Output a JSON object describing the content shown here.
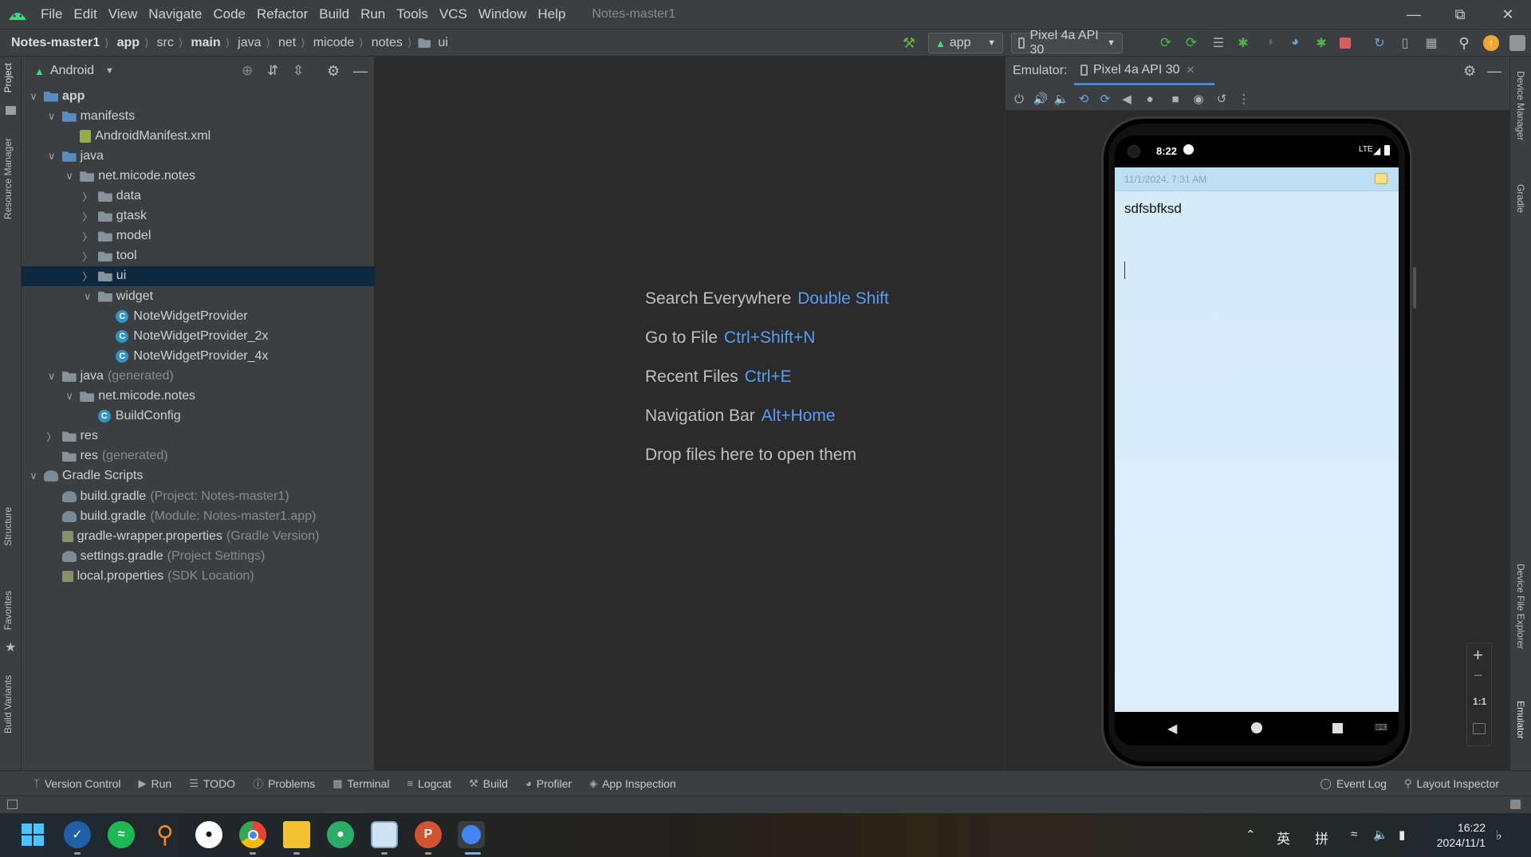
{
  "menubar": {
    "items": [
      "File",
      "Edit",
      "View",
      "Navigate",
      "Code",
      "Refactor",
      "Build",
      "Run",
      "Tools",
      "VCS",
      "Window",
      "Help"
    ],
    "project_title": "Notes-master1"
  },
  "breadcrumbs": [
    "Notes-master1",
    "app",
    "src",
    "main",
    "java",
    "net",
    "micode",
    "notes",
    "ui"
  ],
  "toolbar": {
    "run_config": "app",
    "device": "Pixel 4a API 30"
  },
  "left_tabs": [
    "Project",
    "Resource Manager",
    "Structure",
    "Favorites",
    "Build Variants"
  ],
  "right_tabs": [
    "Device Manager",
    "Gradle",
    "Device File Explorer",
    "Emulator"
  ],
  "project_panel": {
    "view_mode": "Android",
    "tree": [
      {
        "label": "app",
        "indent": 0,
        "expanded": true,
        "icon": "module-folder"
      },
      {
        "label": "manifests",
        "indent": 1,
        "expanded": true,
        "icon": "folder"
      },
      {
        "label": "AndroidManifest.xml",
        "indent": 2,
        "icon": "manifest-file"
      },
      {
        "label": "java",
        "indent": 1,
        "expanded": true,
        "icon": "folder"
      },
      {
        "label": "net.micode.notes",
        "indent": 2,
        "expanded": true,
        "icon": "package"
      },
      {
        "label": "data",
        "indent": 3,
        "expanded": false,
        "icon": "package"
      },
      {
        "label": "gtask",
        "indent": 3,
        "expanded": false,
        "icon": "package"
      },
      {
        "label": "model",
        "indent": 3,
        "expanded": false,
        "icon": "package"
      },
      {
        "label": "tool",
        "indent": 3,
        "expanded": false,
        "icon": "package"
      },
      {
        "label": "ui",
        "indent": 3,
        "expanded": false,
        "icon": "package",
        "selected": true
      },
      {
        "label": "widget",
        "indent": 3,
        "expanded": true,
        "icon": "package"
      },
      {
        "label": "NoteWidgetProvider",
        "indent": 4,
        "icon": "class"
      },
      {
        "label": "NoteWidgetProvider_2x",
        "indent": 4,
        "icon": "class"
      },
      {
        "label": "NoteWidgetProvider_4x",
        "indent": 4,
        "icon": "class"
      },
      {
        "label": "java",
        "note": "(generated)",
        "indent": 1,
        "expanded": true,
        "icon": "generated-folder"
      },
      {
        "label": "net.micode.notes",
        "indent": 2,
        "expanded": true,
        "icon": "package"
      },
      {
        "label": "BuildConfig",
        "indent": 3,
        "icon": "class"
      },
      {
        "label": "res",
        "indent": 1,
        "expanded": false,
        "icon": "res-folder"
      },
      {
        "label": "res",
        "note": "(generated)",
        "indent": 1,
        "icon": "res-folder"
      },
      {
        "label": "Gradle Scripts",
        "indent": 0,
        "expanded": true,
        "icon": "gradle"
      },
      {
        "label": "build.gradle",
        "note": "(Project: Notes-master1)",
        "indent": 1,
        "icon": "gradle"
      },
      {
        "label": "build.gradle",
        "note": "(Module: Notes-master1.app)",
        "indent": 1,
        "icon": "gradle"
      },
      {
        "label": "gradle-wrapper.properties",
        "note": "(Gradle Version)",
        "indent": 1,
        "icon": "properties"
      },
      {
        "label": "settings.gradle",
        "note": "(Project Settings)",
        "indent": 1,
        "icon": "gradle"
      },
      {
        "label": "local.properties",
        "note": "(SDK Location)",
        "indent": 1,
        "icon": "properties"
      }
    ]
  },
  "editor_hints": [
    {
      "text": "Search Everywhere",
      "key": "Double Shift"
    },
    {
      "text": "Go to File",
      "key": "Ctrl+Shift+N"
    },
    {
      "text": "Recent Files",
      "key": "Ctrl+E"
    },
    {
      "text": "Navigation Bar",
      "key": "Alt+Home"
    },
    {
      "text": "Drop files here to open them",
      "key": ""
    }
  ],
  "emulator": {
    "label": "Emulator:",
    "tab": "Pixel 4a API 30",
    "zoom_ratio": "1:1",
    "phone": {
      "time": "8:22",
      "network": "LTE",
      "note_date": "11/1/2024, 7:31 AM",
      "note_text": "sdfsbfksd"
    }
  },
  "bottom_tools": {
    "left": [
      "Version Control",
      "Run",
      "TODO",
      "Problems",
      "Terminal",
      "Logcat",
      "Build",
      "Profiler",
      "App Inspection"
    ],
    "right": [
      "Event Log",
      "Layout Inspector"
    ]
  },
  "taskbar": {
    "ime_lang": "英",
    "ime_mode": "拼",
    "time": "16:22",
    "date": "2024/11/1"
  }
}
